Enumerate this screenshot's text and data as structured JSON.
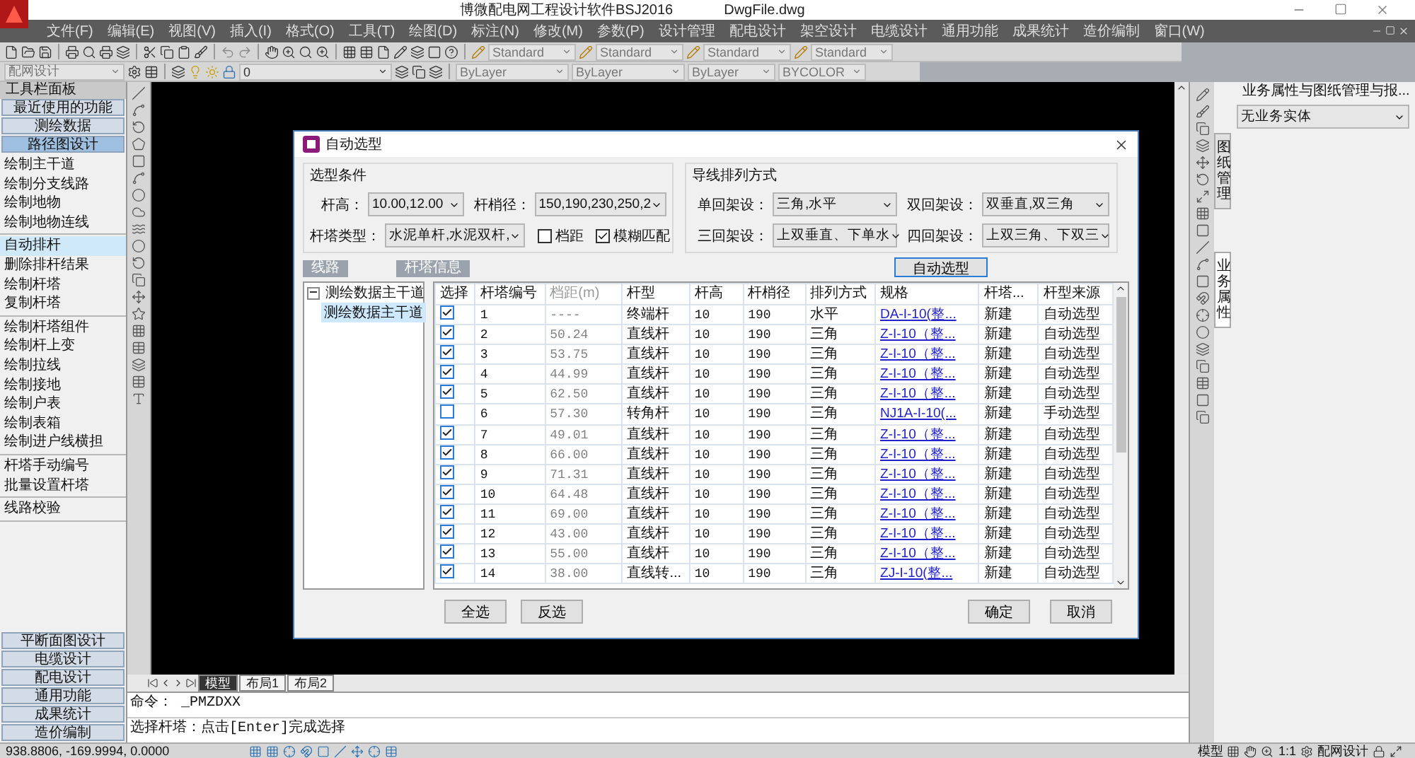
{
  "window": {
    "title": "博微配电网工程设计软件BSJ2016",
    "document": "DwgFile.dwg"
  },
  "menu": [
    "文件(F)",
    "编辑(E)",
    "视图(V)",
    "插入(I)",
    "格式(O)",
    "工具(T)",
    "绘图(D)",
    "标注(N)",
    "修改(M)",
    "参数(P)",
    "设计管理",
    "配电设计",
    "架空设计",
    "电缆设计",
    "通用功能",
    "成果统计",
    "造价编制",
    "窗口(W)"
  ],
  "toolbar_styles": [
    "Standard",
    "Standard",
    "Standard",
    "Standard"
  ],
  "toolbar_layers": {
    "workspace": "配网设计",
    "layer": "0",
    "object_color": "ByLayer",
    "linetype": "ByLayer",
    "lineweight": "ByLayer",
    "plotstyle": "BYCOLOR"
  },
  "left_panel": {
    "title": "工具栏面板",
    "sections_top": [
      {
        "label": "最近使用的功能",
        "selected": false
      },
      {
        "label": "测绘数据",
        "selected": false
      },
      {
        "label": "路径图设计",
        "selected": true
      }
    ],
    "groups": [
      [
        {
          "label": "绘制主干道",
          "selected": false
        },
        {
          "label": "绘制分支线路",
          "selected": false
        },
        {
          "label": "绘制地物",
          "selected": false
        },
        {
          "label": "绘制地物连线",
          "selected": false
        }
      ],
      [
        {
          "label": "自动排杆",
          "selected": true
        },
        {
          "label": "删除排杆结果",
          "selected": false
        },
        {
          "label": "绘制杆塔",
          "selected": false
        },
        {
          "label": "复制杆塔",
          "selected": false
        }
      ],
      [
        {
          "label": "绘制杆塔组件",
          "selected": false
        },
        {
          "label": "绘制杆上变",
          "selected": false
        },
        {
          "label": "绘制拉线",
          "selected": false
        },
        {
          "label": "绘制接地",
          "selected": false
        },
        {
          "label": "绘制户表",
          "selected": false
        },
        {
          "label": "绘制表箱",
          "selected": false
        },
        {
          "label": "绘制进户线横担",
          "selected": false
        }
      ],
      [
        {
          "label": "杆塔手动编号",
          "selected": false
        },
        {
          "label": "批量设置杆塔",
          "selected": false
        }
      ],
      [
        {
          "label": "线路校验",
          "selected": false
        }
      ]
    ],
    "sections_bottom": [
      {
        "label": "平断面图设计",
        "selected": false
      },
      {
        "label": "电缆设计",
        "selected": false
      },
      {
        "label": "配电设计",
        "selected": false
      },
      {
        "label": "通用功能",
        "selected": false
      },
      {
        "label": "成果统计",
        "selected": false
      },
      {
        "label": "造价编制",
        "selected": false
      }
    ]
  },
  "dialog": {
    "title": "自动选型",
    "conditions": {
      "title": "选型条件",
      "fields": [
        {
          "label": "杆高：",
          "value": "10.00,12.00"
        },
        {
          "label": "杆梢径：",
          "value": "150,190,230,250,2"
        },
        {
          "label": "杆塔类型：",
          "value": "水泥单杆,水泥双杆,"
        }
      ],
      "options": [
        {
          "label": "档距",
          "checked": false
        },
        {
          "label": "模糊匹配",
          "checked": true
        }
      ]
    },
    "arrangement": {
      "title": "导线排列方式",
      "fields": [
        {
          "label": "单回架设：",
          "value": "三角,水平"
        },
        {
          "label": "双回架设：",
          "value": "双垂直,双三角"
        },
        {
          "label": "三回架设：",
          "value": "上双垂直、下单水"
        },
        {
          "label": "四回架设：",
          "value": "上双三角、下双三"
        }
      ]
    },
    "auto_button": "自动选型",
    "line_tab": "线路",
    "tower_tab": "杆塔信息",
    "tree": [
      {
        "label": "测绘数据主干道",
        "expanded": true,
        "children": [
          {
            "label": "测绘数据主干道",
            "selected": true
          }
        ]
      }
    ],
    "columns": [
      {
        "label": "选择",
        "kind": "check",
        "disabled": false
      },
      {
        "label": "杆塔编号",
        "kind": "text",
        "disabled": false
      },
      {
        "label": "档距(m)",
        "kind": "text",
        "disabled": true
      },
      {
        "label": "杆型",
        "kind": "text",
        "disabled": false
      },
      {
        "label": "杆高",
        "kind": "text",
        "disabled": false
      },
      {
        "label": "杆梢径",
        "kind": "text",
        "disabled": false
      },
      {
        "label": "排列方式",
        "kind": "text",
        "disabled": false
      },
      {
        "label": "规格",
        "kind": "link",
        "disabled": false
      },
      {
        "label": "杆塔...",
        "kind": "text",
        "disabled": false
      },
      {
        "label": "杆型来源",
        "kind": "text",
        "disabled": false
      }
    ],
    "rows": [
      {
        "checked": true,
        "cells": [
          "",
          "1",
          "----",
          "终端杆",
          "10",
          "190",
          "水平",
          "DA-I-10(整...",
          "新建",
          "自动选型"
        ]
      },
      {
        "checked": true,
        "cells": [
          "",
          "2",
          "50.24",
          "直线杆",
          "10",
          "190",
          "三角",
          "Z-I-10（整...",
          "新建",
          "自动选型"
        ]
      },
      {
        "checked": true,
        "cells": [
          "",
          "3",
          "53.75",
          "直线杆",
          "10",
          "190",
          "三角",
          "Z-I-10（整...",
          "新建",
          "自动选型"
        ]
      },
      {
        "checked": true,
        "cells": [
          "",
          "4",
          "44.99",
          "直线杆",
          "10",
          "190",
          "三角",
          "Z-I-10（整...",
          "新建",
          "自动选型"
        ]
      },
      {
        "checked": true,
        "cells": [
          "",
          "5",
          "62.50",
          "直线杆",
          "10",
          "190",
          "三角",
          "Z-I-10（整...",
          "新建",
          "自动选型"
        ]
      },
      {
        "checked": false,
        "cells": [
          "",
          "6",
          "57.30",
          "转角杆",
          "10",
          "190",
          "三角",
          "NJ1A-I-10(...",
          "新建",
          "手动选型"
        ]
      },
      {
        "checked": true,
        "cells": [
          "",
          "7",
          "49.01",
          "直线杆",
          "10",
          "190",
          "三角",
          "Z-I-10（整...",
          "新建",
          "自动选型"
        ]
      },
      {
        "checked": true,
        "cells": [
          "",
          "8",
          "66.00",
          "直线杆",
          "10",
          "190",
          "三角",
          "Z-I-10（整...",
          "新建",
          "自动选型"
        ]
      },
      {
        "checked": true,
        "cells": [
          "",
          "9",
          "71.31",
          "直线杆",
          "10",
          "190",
          "三角",
          "Z-I-10（整...",
          "新建",
          "自动选型"
        ]
      },
      {
        "checked": true,
        "cells": [
          "",
          "10",
          "64.48",
          "直线杆",
          "10",
          "190",
          "三角",
          "Z-I-10（整...",
          "新建",
          "自动选型"
        ]
      },
      {
        "checked": true,
        "cells": [
          "",
          "11",
          "69.00",
          "直线杆",
          "10",
          "190",
          "三角",
          "Z-I-10（整...",
          "新建",
          "自动选型"
        ]
      },
      {
        "checked": true,
        "cells": [
          "",
          "12",
          "43.00",
          "直线杆",
          "10",
          "190",
          "三角",
          "Z-I-10（整...",
          "新建",
          "自动选型"
        ]
      },
      {
        "checked": true,
        "cells": [
          "",
          "13",
          "55.00",
          "直线杆",
          "10",
          "190",
          "三角",
          "Z-I-10（整...",
          "新建",
          "自动选型"
        ]
      },
      {
        "checked": true,
        "cells": [
          "",
          "14",
          "38.00",
          "直线转...",
          "10",
          "190",
          "三角",
          "ZJ-I-10(整...",
          "新建",
          "自动选型"
        ]
      }
    ],
    "footer_left": [
      "全选",
      "反选"
    ],
    "footer_right": [
      "确定",
      "取消"
    ]
  },
  "layout_tabs": [
    {
      "label": "模型",
      "selected": true
    },
    {
      "label": "布局1",
      "selected": false
    },
    {
      "label": "布局2",
      "selected": false
    }
  ],
  "command": {
    "history": "命令： _PMZDXX",
    "prompt": "选择杆塔：点击[Enter]完成选择"
  },
  "right_panel": {
    "title": "业务属性与图纸管理与报...",
    "entity": "无业务实体",
    "tabs": [
      {
        "label": "图纸管理",
        "selected": false
      },
      {
        "label": "业务属性",
        "selected": true
      }
    ]
  },
  "status_bar": {
    "coordinates": "938.8806,  -169.9994, 0.0000",
    "space": "模型",
    "scale": "1:1",
    "workspace": "配网设计"
  }
}
